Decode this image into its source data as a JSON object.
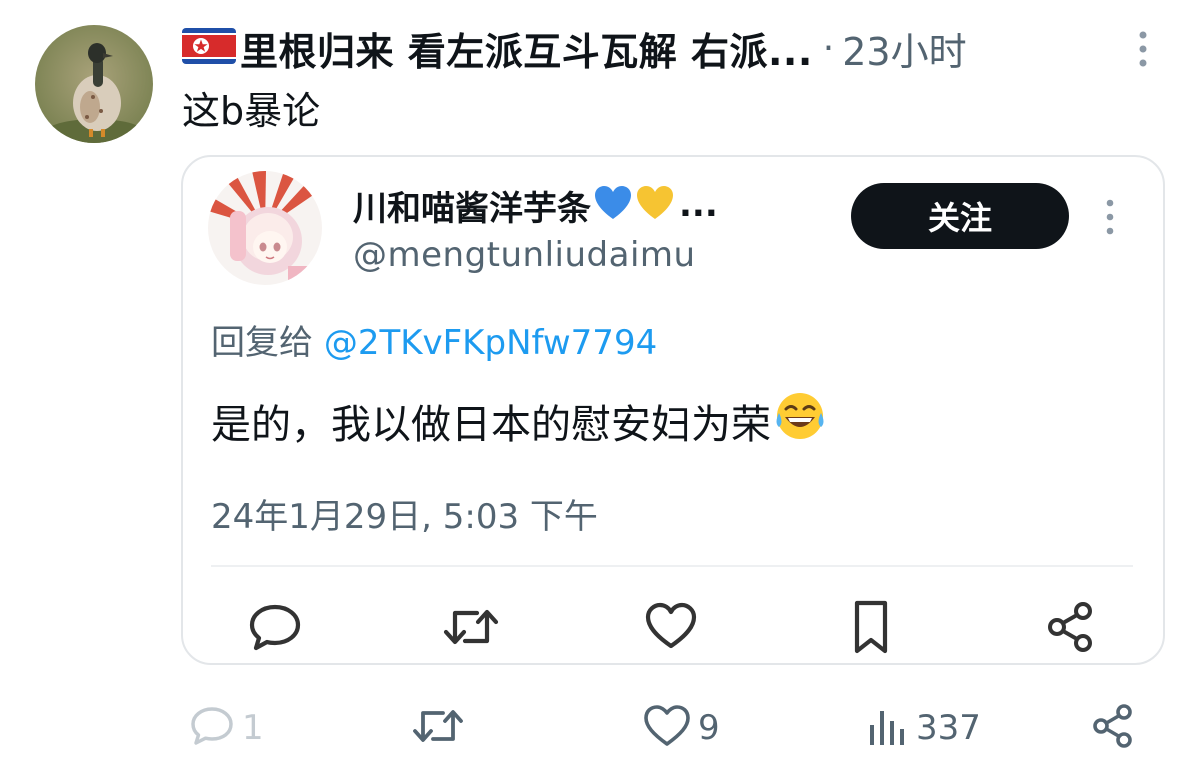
{
  "tweet": {
    "author_name": "里根归来 看左派互斗瓦解 右派...",
    "separator": "·",
    "time": "23小时",
    "text": "这b暴论"
  },
  "quote": {
    "name": "川和喵酱洋芋条",
    "name_suffix": "...",
    "handle": "@mengtunliudaimu",
    "follow_label": "关注",
    "reply_prefix": "回复给",
    "reply_mention": "@2TKvFKpNfw7794",
    "text": "是的，我以做日本的慰安妇为荣",
    "date": "24年1月29日, 5:03 下午",
    "actions": [
      "reply-icon",
      "retweet-icon",
      "like-icon",
      "bookmark-icon",
      "share-icon"
    ]
  },
  "stats": {
    "replies": "1",
    "likes": "9",
    "views": "337"
  },
  "colors": {
    "text": "#0f1419",
    "secondary": "#536471",
    "link": "#1d9bf0",
    "border": "#e3e6e9",
    "button_bg": "#0f1419"
  }
}
